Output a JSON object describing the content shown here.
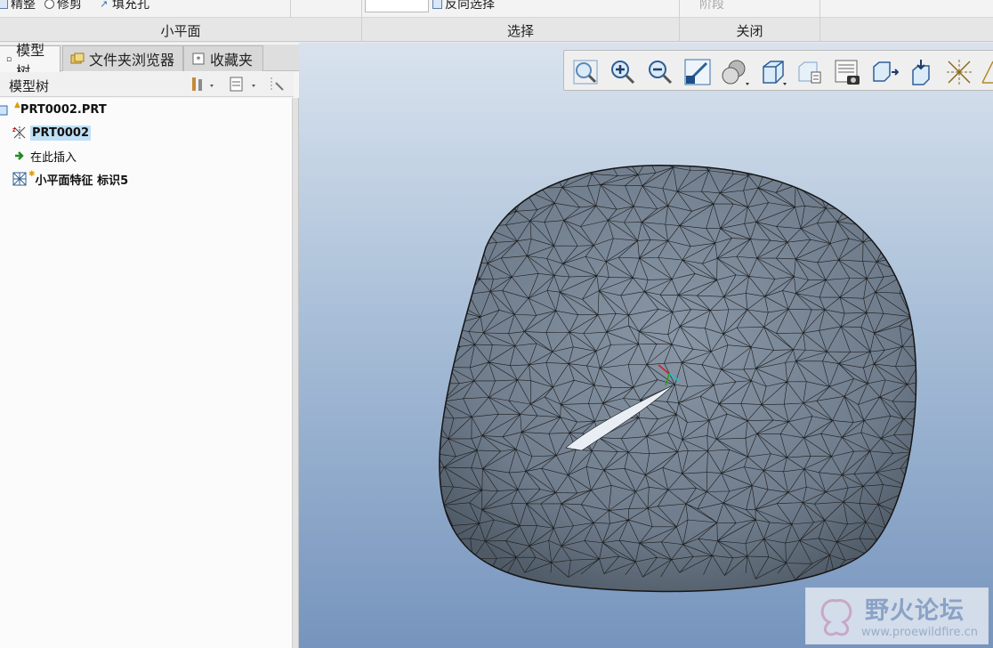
{
  "ribbon": {
    "buttons": [
      {
        "label": "精整",
        "icon": "refine-icon"
      },
      {
        "label": "修剪",
        "icon": "trim-icon"
      },
      {
        "label": "填充孔",
        "icon": "fill-hole-icon"
      },
      {
        "label": "反向选择",
        "icon": "invert-selection-icon"
      },
      {
        "label": "阶段",
        "icon": "stage-icon"
      }
    ],
    "groups": [
      "小平面",
      "选择",
      "关闭"
    ]
  },
  "model_tree": {
    "tabs": [
      "模型树",
      "文件夹浏览器",
      "收藏夹"
    ],
    "header_title": "模型树",
    "items": [
      {
        "label": "PRT0002.PRT",
        "icon": "part-icon"
      },
      {
        "label": "PRT0002",
        "icon": "facet-feature-icon"
      },
      {
        "label": "在此插入",
        "icon": "insert-here-arrow-icon"
      },
      {
        "label": "小平面特征 标识5",
        "icon": "facet-mesh-icon"
      }
    ]
  },
  "view_toolbar": {
    "icons": [
      "refit-icon",
      "zoom-in-icon",
      "zoom-out-icon",
      "repaint-icon",
      "display-style-icon",
      "saved-views-icon",
      "standard-orientation-icon",
      "view-manager-icon",
      "perspective-icon",
      "spin-center-icon",
      "annotation-display-icon",
      "datum-display-icon",
      "datum-planes-icon"
    ]
  },
  "colors": {
    "mesh_fill": "#6f7c8c",
    "mesh_line": "#1a1a1a",
    "selection_highlight": "#bfe0f6"
  },
  "watermark": {
    "title": "野火论坛",
    "url": "www.proewildfire.cn"
  }
}
